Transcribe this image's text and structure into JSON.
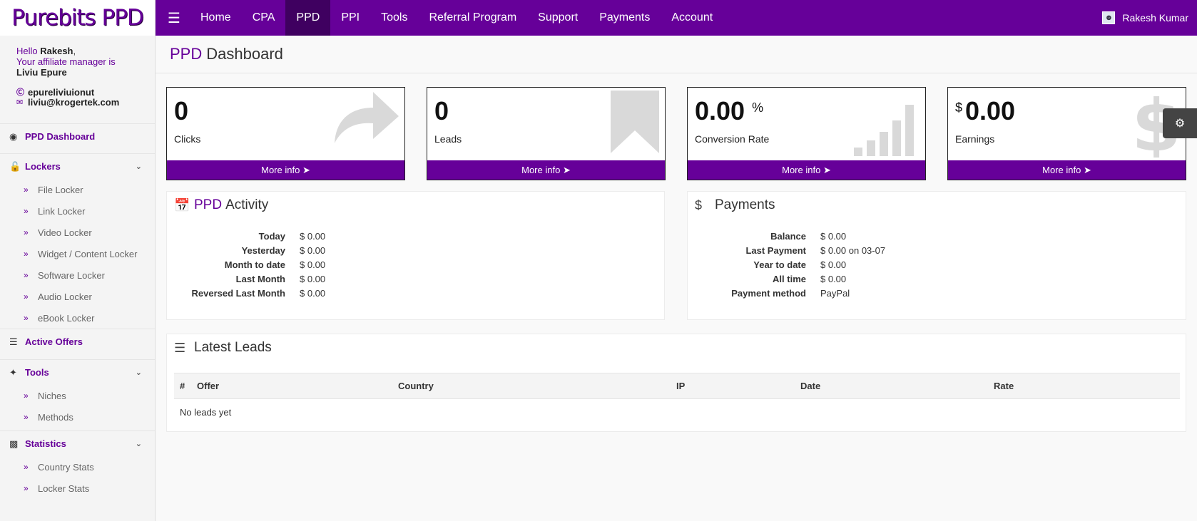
{
  "logo": "Purebits PPD",
  "nav": {
    "menu_icon": "hamburger-icon",
    "items": [
      "Home",
      "CPA",
      "PPD",
      "PPI",
      "Tools",
      "Referral Program",
      "Support",
      "Payments",
      "Account"
    ],
    "active": "PPD",
    "user_name": "Rakesh Kumar"
  },
  "sidebar": {
    "hello": "Hello",
    "user_first": "Rakesh",
    "manager_label": "Your affiliate manager is",
    "manager_name": "Liviu Epure",
    "skype": "epureliviuionut",
    "email": "liviu@krogertek.com",
    "dashboard": "PPD Dashboard",
    "lockers": {
      "label": "Lockers",
      "items": [
        "File Locker",
        "Link Locker",
        "Video Locker",
        "Widget / Content Locker",
        "Software Locker",
        "Audio Locker",
        "eBook Locker"
      ]
    },
    "active_offers": "Active Offers",
    "tools": {
      "label": "Tools",
      "items": [
        "Niches",
        "Methods"
      ]
    },
    "statistics": {
      "label": "Statistics",
      "items": [
        "Country Stats",
        "Locker Stats"
      ]
    }
  },
  "page": {
    "title_accent": "PPD",
    "title_rest": "Dashboard"
  },
  "stats": [
    {
      "value": "0",
      "label": "Clicks",
      "more": "More info",
      "icon": "share-arrow-icon"
    },
    {
      "value": "0",
      "label": "Leads",
      "more": "More info",
      "icon": "bookmark-icon"
    },
    {
      "value": "0.00",
      "suffix": "%",
      "label": "Conversion Rate",
      "more": "More info",
      "icon": "signal-bars-icon"
    },
    {
      "value": "0.00",
      "prefix": "$",
      "label": "Earnings",
      "more": "More info",
      "icon": "dollar-icon"
    }
  ],
  "activity": {
    "title_accent": "PPD",
    "title_rest": "Activity",
    "rows": [
      {
        "k": "Today",
        "v": "$ 0.00"
      },
      {
        "k": "Yesterday",
        "v": "$ 0.00"
      },
      {
        "k": "Month to date",
        "v": "$ 0.00"
      },
      {
        "k": "Last Month",
        "v": "$ 0.00"
      },
      {
        "k": "Reversed Last Month",
        "v": "$ 0.00"
      }
    ]
  },
  "payments": {
    "title": "Payments",
    "rows": [
      {
        "k": "Balance",
        "v": "$ 0.00"
      },
      {
        "k": "Last Payment",
        "v": "$ 0.00 on 03-07"
      },
      {
        "k": "Year to date",
        "v": "$ 0.00"
      },
      {
        "k": "All time",
        "v": "$ 0.00"
      },
      {
        "k": "Payment method",
        "v": "PayPal"
      }
    ]
  },
  "leads": {
    "title": "Latest Leads",
    "columns": [
      "#",
      "Offer",
      "Country",
      "IP",
      "Date",
      "Rate"
    ],
    "empty": "No leads yet"
  },
  "colors": {
    "brand": "#660099",
    "brand_dark": "#3f0060"
  }
}
